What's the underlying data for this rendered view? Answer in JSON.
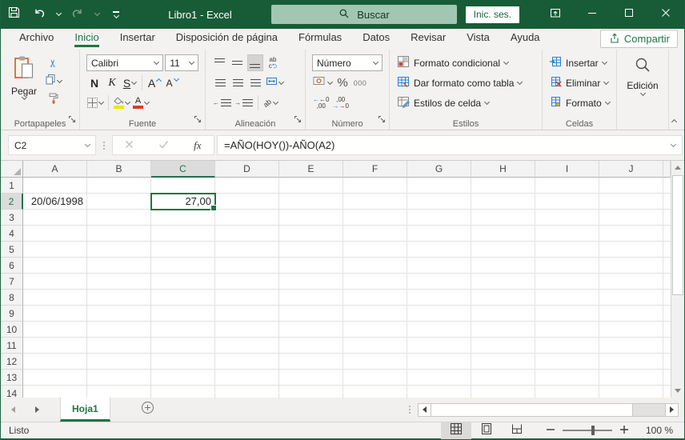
{
  "window": {
    "title": "Libro1 - Excel"
  },
  "titlebar": {
    "search_placeholder": "Buscar",
    "signin": "Inic. ses."
  },
  "tabs": {
    "items": [
      {
        "label": "Archivo"
      },
      {
        "label": "Inicio",
        "active": true
      },
      {
        "label": "Insertar"
      },
      {
        "label": "Disposición de página"
      },
      {
        "label": "Fórmulas"
      },
      {
        "label": "Datos"
      },
      {
        "label": "Revisar"
      },
      {
        "label": "Vista"
      },
      {
        "label": "Ayuda"
      }
    ],
    "share": "Compartir"
  },
  "ribbon": {
    "clipboard": {
      "label": "Portapapeles",
      "paste": "Pegar"
    },
    "font": {
      "label": "Fuente",
      "family": "Calibri",
      "size": "11",
      "bold": "N",
      "italic": "K",
      "underline": "S",
      "grow": "A",
      "shrink": "A",
      "color_letter": "A"
    },
    "alignment": {
      "label": "Alineación",
      "wrap_top": "ab",
      "wrap_bot": "c",
      "orient": "ab"
    },
    "number": {
      "label": "Número",
      "format": "Número",
      "percent": "%",
      "thousands": "000",
      "inc_top": "←0",
      "inc_bot": ",00",
      "dec_top": ",00",
      "dec_bot": "→0"
    },
    "styles": {
      "label": "Estilos",
      "items": [
        "Formato condicional",
        "Dar formato como tabla",
        "Estilos de celda"
      ]
    },
    "cells": {
      "label": "Celdas",
      "items": [
        "Insertar",
        "Eliminar",
        "Formato"
      ]
    },
    "editing": {
      "label": "Edición"
    }
  },
  "formula_bar": {
    "name_box": "C2",
    "fx": "fx",
    "formula": "=AÑO(HOY())-AÑO(A2)"
  },
  "grid": {
    "columns": [
      "A",
      "B",
      "C",
      "D",
      "E",
      "F",
      "G",
      "H",
      "I",
      "J"
    ],
    "rows": [
      "1",
      "2",
      "3",
      "4",
      "5",
      "6",
      "7",
      "8",
      "9",
      "10",
      "11",
      "12",
      "13",
      "14"
    ],
    "cells": {
      "A2": "20/06/1998",
      "C2": "27,00"
    },
    "selection": {
      "col": "C",
      "row": "2",
      "cell": "C2"
    }
  },
  "sheet_bar": {
    "active_tab": "Hoja1"
  },
  "status_bar": {
    "status": "Listo",
    "zoom": "100 %"
  },
  "colors": {
    "titlebar_green": "#185c37",
    "accent_green": "#217346",
    "fill_color_bar": "#f5e400",
    "font_color_bar": "#d6411f",
    "selection_border": "#217346"
  }
}
